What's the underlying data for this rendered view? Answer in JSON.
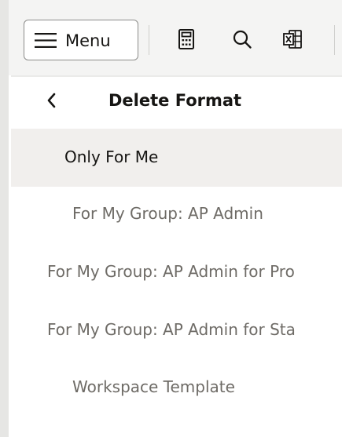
{
  "toolbar": {
    "menu_label": "Menu",
    "icons": [
      "calculator-icon",
      "search-icon",
      "export-excel-icon"
    ]
  },
  "panel": {
    "title": "Delete Format",
    "back_icon": "chevron-left-icon",
    "items": [
      {
        "label": "Only For Me",
        "selected": true
      },
      {
        "label": "For My Group: AP Admin",
        "selected": false
      },
      {
        "label": "For My Group: AP Admin for Pro",
        "selected": false
      },
      {
        "label": "For My Group: AP Admin for Sta",
        "selected": false
      },
      {
        "label": "Workspace Template",
        "selected": false
      }
    ]
  },
  "colors": {
    "toolbar_bg": "#f4f4f3",
    "selected_bg": "#f1efed",
    "text_primary": "#161513",
    "text_secondary": "#6e6b66"
  }
}
